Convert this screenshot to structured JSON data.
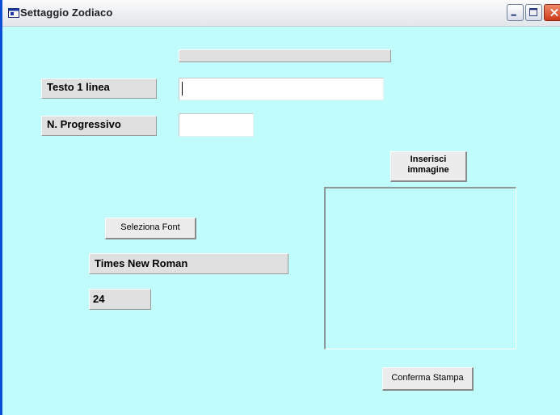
{
  "window": {
    "title": "Settaggio Zodiaco",
    "icon": "app-window-icon",
    "buttons": {
      "minimize": "minimize-icon",
      "maximize": "maximize-icon",
      "close": "close-icon"
    }
  },
  "form": {
    "top_bar_text": "",
    "text_line_label": "Testo 1 linea",
    "text_line_value": "",
    "progressive_label": "N. Progressivo",
    "progressive_value": "",
    "select_font_button": "Seleziona Font",
    "font_name": "Times New Roman",
    "font_size": "24",
    "insert_image_button_line1": "Inserisci",
    "insert_image_button_line2": "immagine",
    "confirm_print_button": "Conferma Stampa"
  },
  "colors": {
    "form_background": "#c0fcfc",
    "title_bar": "#eef0f3",
    "label_background": "#e0e0e0",
    "close_button": "#cc3a1a"
  }
}
